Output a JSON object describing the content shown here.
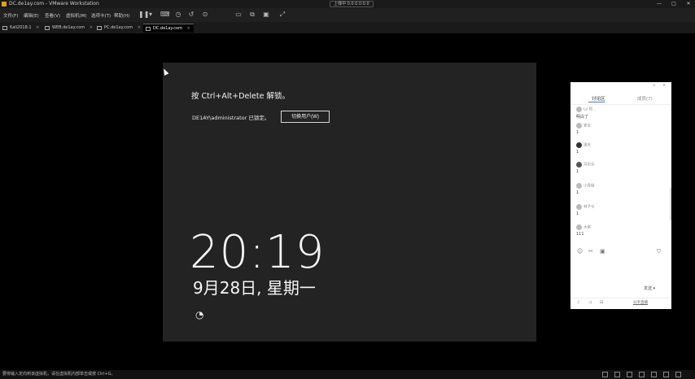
{
  "window": {
    "title": "DC.de1ay.com - VMware Workstation",
    "center_label": "上傳中 0.0.0.0:0.0",
    "min": "—",
    "max": "□",
    "close": "✕"
  },
  "menu": {
    "items": [
      "文件(F)",
      "编辑(E)",
      "查看(V)",
      "虚拟机(M)",
      "选项卡(T)",
      "帮助(H)"
    ],
    "tools": [
      "pause-icon",
      "chevron-down-icon",
      "send-keys-icon",
      "snapshot-icon",
      "revert-icon",
      "manage-snapshots-icon",
      "fullscreen-icon",
      "unity-icon",
      "console-icon",
      "stretch-icon"
    ]
  },
  "tabs": [
    {
      "label": "Kali2018.1",
      "active": false
    },
    {
      "label": "WEB.de1ay.com",
      "active": false
    },
    {
      "label": "PC.de1ay.com",
      "active": false
    },
    {
      "label": "DC.de1ay.com",
      "active": true
    }
  ],
  "vm": {
    "hint": "按 Ctrl+Alt+Delete 解锁。",
    "locked_user": "DE1AY\\administrator 已锁定。",
    "switch_user": "切换用户(W)",
    "time": "20:19",
    "date": "9月28日, 星期一"
  },
  "chat": {
    "tab_chat": "讨论区",
    "tab_members": "成员(7)",
    "messages": [
      {
        "user": "Lo 师...",
        "text": "明白了"
      },
      {
        "user": "安全",
        "text": "1"
      },
      {
        "user": "琉光",
        "text": "1"
      },
      {
        "user": "可乐乐",
        "text": "1"
      },
      {
        "user": "小青蛙",
        "text": "1"
      },
      {
        "user": "林子兮",
        "text": "1"
      },
      {
        "user": "大佬",
        "text": "111"
      }
    ],
    "send": "发送 ▾",
    "bottom_link": "分享直播"
  },
  "status": {
    "text": "要将输入定向到该虚拟机，请在虚拟机内部单击或按 Ctrl+G。"
  }
}
